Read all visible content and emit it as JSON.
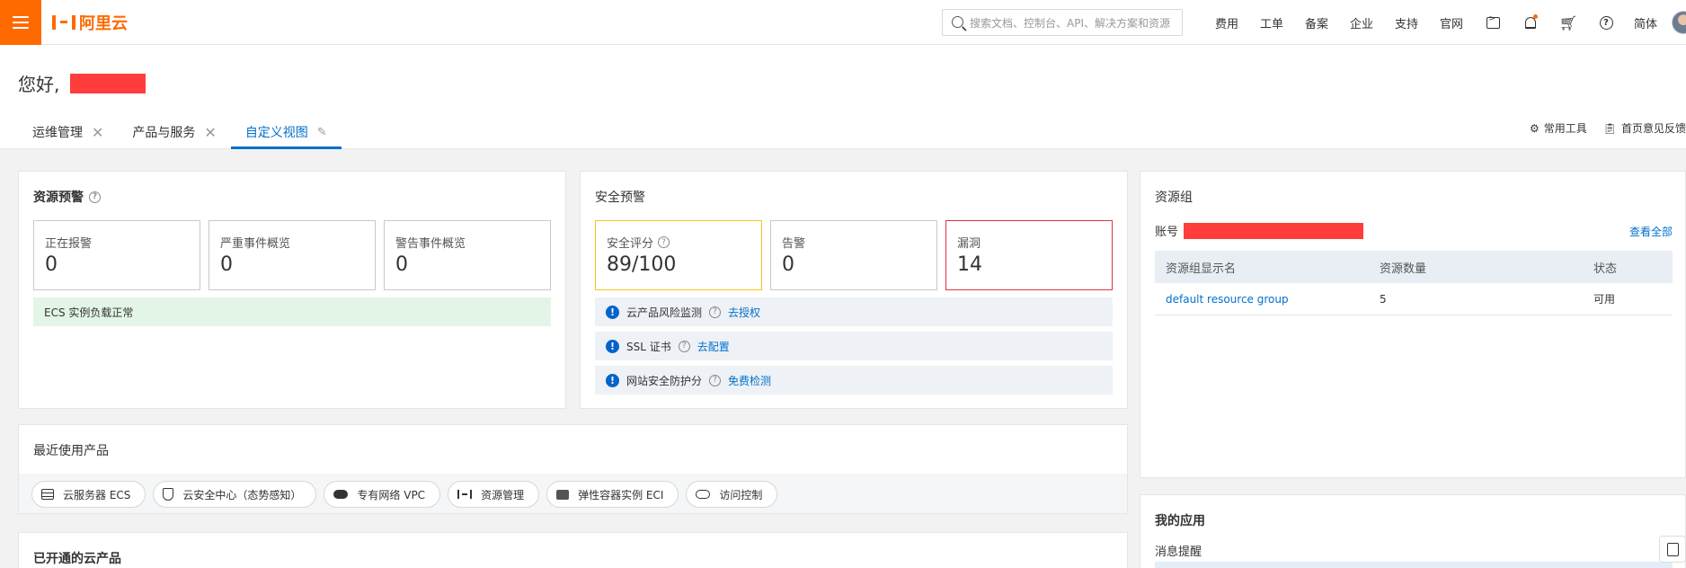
{
  "topbar": {
    "brand": "阿里云",
    "search_placeholder": "搜索文档、控制台、API、解决方案和资源",
    "links": [
      "费用",
      "工单",
      "备案",
      "企业",
      "支持",
      "官网"
    ],
    "language": "简体",
    "icons": [
      "menu-icon",
      "search-icon",
      "terminal-icon",
      "bell-icon",
      "cart-icon",
      "help-icon",
      "avatar"
    ]
  },
  "header": {
    "greeting": "您好,",
    "tabs": [
      {
        "label": "运维管理",
        "active": false
      },
      {
        "label": "产品与服务",
        "active": false
      },
      {
        "label": "自定义视图",
        "active": true
      }
    ],
    "tools": {
      "common_tools": "常用工具",
      "feedback": "首页意见反馈"
    }
  },
  "resource_alert": {
    "title": "资源预警",
    "stats": [
      {
        "label": "正在报警",
        "value": "0"
      },
      {
        "label": "严重事件概览",
        "value": "0"
      },
      {
        "label": "警告事件概览",
        "value": "0"
      }
    ],
    "notice": "ECS 实例负载正常"
  },
  "security_alert": {
    "title": "安全预警",
    "stats": [
      {
        "label": "安全评分",
        "value": "89/100"
      },
      {
        "label": "告警",
        "value": "0"
      },
      {
        "label": "漏洞",
        "value": "14"
      }
    ],
    "rows": [
      {
        "label": "云产品风险监测",
        "action": "去授权"
      },
      {
        "label": "SSL 证书",
        "action": "去配置"
      },
      {
        "label": "网站安全防护分",
        "action": "免费检测"
      }
    ],
    "colors": {
      "score_border": "#f5c518",
      "vuln_border": "#e0333f"
    }
  },
  "resource_group": {
    "title": "资源组",
    "account_label": "账号",
    "view_all": "查看全部",
    "columns": [
      "资源组显示名",
      "资源数量",
      "状态"
    ],
    "rows": [
      {
        "name": "default resource group",
        "count": "5",
        "status": "可用"
      }
    ]
  },
  "recent_products": {
    "title": "最近使用产品",
    "items": [
      "云服务器 ECS",
      "云安全中心（态势感知）",
      "专有网络 VPC",
      "资源管理",
      "弹性容器实例 ECI",
      "访问控制"
    ]
  },
  "enabled_products": {
    "title": "已开通的云产品"
  },
  "my_apps": {
    "title": "我的应用",
    "subtitle": "消息提醒"
  },
  "theme": {
    "brand": "#ff6a00",
    "link": "#0070cc"
  }
}
